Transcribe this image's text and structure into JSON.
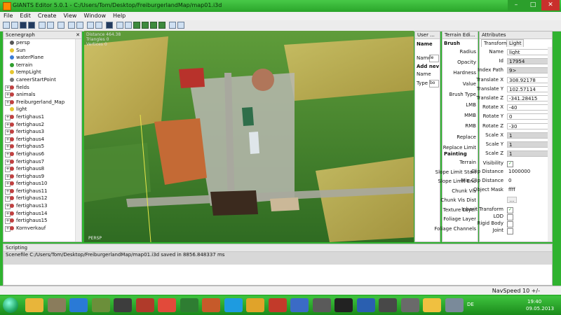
{
  "window": {
    "title": "GIANTS Editor 5.0.1 - C:/Users/Tom/Desktop/FreiburgerlandMap/map01.i3d"
  },
  "menu": [
    "File",
    "Edit",
    "Create",
    "View",
    "Window",
    "Help"
  ],
  "scenegraph": {
    "title": "Scenegraph",
    "close": "✕",
    "items": [
      {
        "label": "persp",
        "icon": "camera-icon",
        "color": "#555555",
        "expand": false
      },
      {
        "label": "Sun",
        "icon": "light-icon",
        "color": "#e6c62e",
        "expand": false
      },
      {
        "label": "waterPlane",
        "icon": "shape-icon",
        "color": "#3a7bd5",
        "expand": false
      },
      {
        "label": "terrain",
        "icon": "terrain-icon",
        "color": "#2e9e2e",
        "expand": false
      },
      {
        "label": "tempLight",
        "icon": "light-icon",
        "color": "#e6c62e",
        "expand": false
      },
      {
        "label": "careerStartPoint",
        "icon": "transform-icon",
        "color": "#777777",
        "expand": false
      },
      {
        "label": "fields",
        "icon": "group-icon",
        "color": "#c04040",
        "expand": true
      },
      {
        "label": "animals",
        "icon": "group-icon",
        "color": "#c04040",
        "expand": true
      },
      {
        "label": "Freiburgerland_Map",
        "icon": "group-icon",
        "color": "#c04040",
        "expand": true
      },
      {
        "label": "light",
        "icon": "light-icon",
        "color": "#e6c62e",
        "expand": false
      },
      {
        "label": "fertighaus1",
        "icon": "group-icon",
        "color": "#c04040",
        "expand": true
      },
      {
        "label": "fertighaus2",
        "icon": "group-icon",
        "color": "#c04040",
        "expand": true
      },
      {
        "label": "fertighaus3",
        "icon": "group-icon",
        "color": "#c04040",
        "expand": true
      },
      {
        "label": "fertighaus4",
        "icon": "group-icon",
        "color": "#c04040",
        "expand": true
      },
      {
        "label": "fertighaus5",
        "icon": "group-icon",
        "color": "#c04040",
        "expand": true
      },
      {
        "label": "fertighaus6",
        "icon": "group-icon",
        "color": "#c04040",
        "expand": true
      },
      {
        "label": "fertighaus7",
        "icon": "group-icon",
        "color": "#c04040",
        "expand": true
      },
      {
        "label": "fertighaus8",
        "icon": "group-icon",
        "color": "#c04040",
        "expand": true
      },
      {
        "label": "fertighaus9",
        "icon": "group-icon",
        "color": "#c04040",
        "expand": true
      },
      {
        "label": "fertighaus10",
        "icon": "group-icon",
        "color": "#c04040",
        "expand": true
      },
      {
        "label": "fertighaus11",
        "icon": "group-icon",
        "color": "#c04040",
        "expand": true
      },
      {
        "label": "fertighaus12",
        "icon": "group-icon",
        "color": "#c04040",
        "expand": true
      },
      {
        "label": "fertighaus13",
        "icon": "group-icon",
        "color": "#c04040",
        "expand": true
      },
      {
        "label": "fertighaus14",
        "icon": "group-icon",
        "color": "#c04040",
        "expand": true
      },
      {
        "label": "fertighaus15",
        "icon": "group-icon",
        "color": "#c04040",
        "expand": true
      },
      {
        "label": "Kornverkauf",
        "icon": "group-icon",
        "color": "#c04040",
        "expand": true
      }
    ]
  },
  "viewport": {
    "stats": [
      "Distance 464.38",
      "Triangles 0",
      "Vertices 0"
    ],
    "camera_label": "PERSP"
  },
  "user_attributes": {
    "title": "User ...",
    "name_header": "Name",
    "name_label": "Name",
    "name_value": "le",
    "add_header": "Add nev",
    "add_name_label": "Name",
    "type_label": "Type",
    "type_value": "bo"
  },
  "terrain_editing": {
    "title": "Terrain Edi...",
    "brush_header": "Brush",
    "brush_labels": [
      "Radius",
      "Opacity",
      "Hardness",
      "Value",
      "Brush Type",
      "LMB",
      "MMB",
      "RMB",
      "Replace",
      "Replace Limit"
    ],
    "painting_header": "Painting",
    "painting_labels": [
      "Terrain",
      "Slope Limit Start",
      "Slope Limit End",
      "Chunk Vis",
      "Chunk Vis Dist",
      "Texture Layer",
      "Foliage Layer",
      "Foliage Channels"
    ]
  },
  "attributes": {
    "title": "Attributes",
    "tabs": [
      "Transform",
      "Light"
    ],
    "fields": [
      {
        "label": "Name",
        "value": "light",
        "gray": false
      },
      {
        "label": "Id",
        "value": "17954",
        "gray": true
      },
      {
        "label": "Index Path",
        "value": "9>",
        "gray": true
      },
      {
        "label": "Translate X",
        "value": "308.92178",
        "gray": false
      },
      {
        "label": "Translate Y",
        "value": "102.57114",
        "gray": false
      },
      {
        "label": "Translate Z",
        "value": "-341.28415",
        "gray": false
      },
      {
        "label": "Rotate X",
        "value": "-40",
        "gray": false
      },
      {
        "label": "Rotate Y",
        "value": "0",
        "gray": false
      },
      {
        "label": "Rotate Z",
        "value": "-30",
        "gray": false
      },
      {
        "label": "Scale X",
        "value": "1",
        "gray": true
      },
      {
        "label": "Scale Y",
        "value": "1",
        "gray": true
      },
      {
        "label": "Scale Z",
        "value": "1",
        "gray": true
      }
    ],
    "visibility_label": "Visibility",
    "visibility_checked": true,
    "clip_distance_label": "Clip Distance",
    "clip_distance_value": "1000000",
    "min_clip_label": "Min Clip Distance",
    "min_clip_value": "0",
    "object_mask_label": "Object Mask",
    "object_mask_value": "ffff",
    "browse_label": "...",
    "checkboxes": [
      {
        "label": "Inherit Transform",
        "checked": true
      },
      {
        "label": "LOD",
        "checked": false
      },
      {
        "label": "Rigid Body",
        "checked": false
      },
      {
        "label": "Joint",
        "checked": false
      }
    ]
  },
  "scripting": {
    "title": "Scripting",
    "output": "Scenefile C:/Users/Tom/Desktop/FreiburgerlandMap/map01.i3d saved in 8856.848337 ms"
  },
  "status": {
    "navspeed": "NavSpeed 10 +/-"
  },
  "taskbar": {
    "language": "DE",
    "time": "19:40",
    "date": "09.05.2013",
    "apps": [
      {
        "name": "explorer-taskbar-icon",
        "color": "#e8b53a"
      },
      {
        "name": "tool-taskbar-icon",
        "color": "#8a7c5c"
      },
      {
        "name": "ie-taskbar-icon",
        "color": "#2a7ad6"
      },
      {
        "name": "minecraft-taskbar-icon",
        "color": "#6b8f3a"
      },
      {
        "name": "app-99-taskbar-icon",
        "color": "#3d3d3d"
      },
      {
        "name": "game-2012-taskbar-icon",
        "color": "#b03a2a"
      },
      {
        "name": "chrome-taskbar-icon",
        "color": "#e24a3a"
      },
      {
        "name": "tractor-taskbar-icon",
        "color": "#2e7d32"
      },
      {
        "name": "giants-taskbar-icon",
        "color": "#c65a2a"
      },
      {
        "name": "skype-taskbar-icon",
        "color": "#1e9be0"
      },
      {
        "name": "paint-taskbar-icon",
        "color": "#e0a32a"
      },
      {
        "name": "truck-taskbar-icon",
        "color": "#c23a2a"
      },
      {
        "name": "farm-taskbar-icon",
        "color": "#3b6bc6"
      },
      {
        "name": "tractor2-taskbar-icon",
        "color": "#5a5a5a"
      },
      {
        "name": "num2-taskbar-icon",
        "color": "#222222"
      },
      {
        "name": "wave-taskbar-icon",
        "color": "#2a5fb0"
      },
      {
        "name": "game-taskbar-icon",
        "color": "#484848"
      },
      {
        "name": "gallery-taskbar-icon",
        "color": "#6a6a6a"
      },
      {
        "name": "giants-editor-taskbar-icon",
        "color": "#f0c040"
      },
      {
        "name": "screen-taskbar-icon",
        "color": "#7a8a9a"
      }
    ]
  }
}
